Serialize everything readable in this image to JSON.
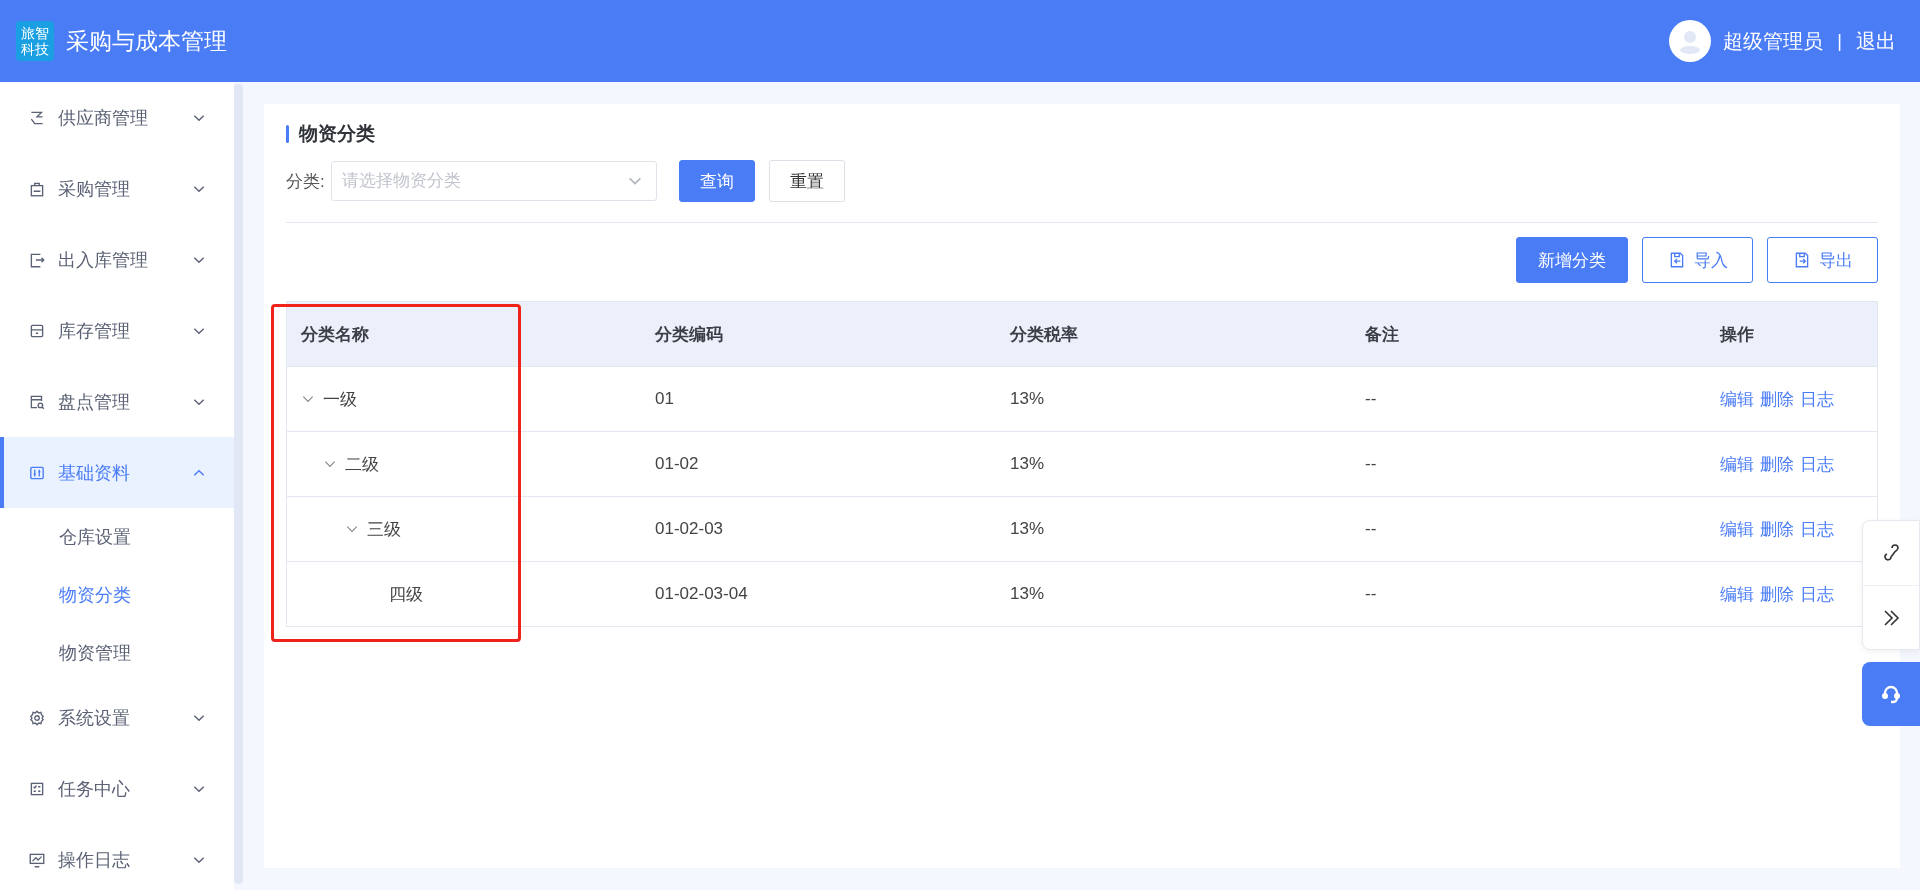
{
  "header": {
    "logo": [
      "旅智",
      "科技"
    ],
    "title": "采购与成本管理",
    "user": "超级管理员",
    "separator": "|",
    "logout": "退出"
  },
  "sidebar": {
    "items": [
      {
        "label": "供应商管理",
        "expanded": false
      },
      {
        "label": "采购管理",
        "expanded": false
      },
      {
        "label": "出入库管理",
        "expanded": false
      },
      {
        "label": "库存管理",
        "expanded": false
      },
      {
        "label": "盘点管理",
        "expanded": false
      },
      {
        "label": "基础资料",
        "expanded": true,
        "children": [
          {
            "label": "仓库设置",
            "selected": false
          },
          {
            "label": "物资分类",
            "selected": true
          },
          {
            "label": "物资管理",
            "selected": false
          }
        ]
      },
      {
        "label": "系统设置",
        "expanded": false
      },
      {
        "label": "任务中心",
        "expanded": false
      },
      {
        "label": "操作日志",
        "expanded": false
      }
    ]
  },
  "page_title": "物资分类",
  "filter": {
    "label": "分类:",
    "placeholder": "请选择物资分类",
    "buttons": [
      {
        "label": "查询",
        "kind": "primary"
      },
      {
        "label": "重置",
        "kind": "default"
      }
    ]
  },
  "toolbar": [
    {
      "label": "新增分类",
      "kind": "primary"
    },
    {
      "label": "导入",
      "kind": "import"
    },
    {
      "label": "导出",
      "kind": "export"
    }
  ],
  "table": {
    "columns": [
      {
        "label": "分类名称",
        "highlighted": true
      },
      {
        "label": "分类编码",
        "highlighted": false
      },
      {
        "label": "分类税率",
        "highlighted": false
      },
      {
        "label": "备注",
        "highlighted": false
      },
      {
        "label": "操作",
        "highlighted": false
      }
    ],
    "rows": [
      {
        "name": "一级",
        "code": "01",
        "rate": "13%",
        "remark": "--",
        "actions": [
          "编辑",
          "删除",
          "日志"
        ],
        "expanded": true,
        "children": [
          {
            "name": "二级",
            "code": "01-02",
            "rate": "13%",
            "remark": "--",
            "actions": [
              "编辑",
              "删除",
              "日志"
            ],
            "expanded": true,
            "children": [
              {
                "name": "三级",
                "code": "01-02-03",
                "rate": "13%",
                "remark": "--",
                "actions": [
                  "编辑",
                  "删除",
                  "日志"
                ],
                "expanded": true,
                "children": [
                  {
                    "name": "四级",
                    "code": "01-02-03-04",
                    "rate": "13%",
                    "remark": "--",
                    "actions": [
                      "编辑",
                      "删除",
                      "日志"
                    ]
                  }
                ]
              }
            ]
          }
        ]
      }
    ]
  }
}
